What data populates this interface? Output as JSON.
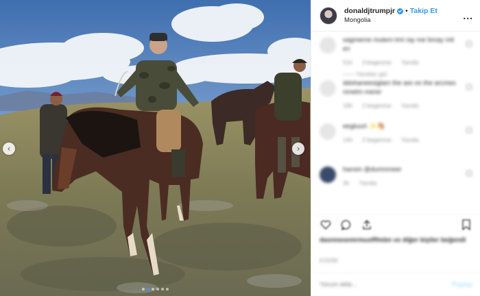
{
  "photo": {
    "description_icon": "photo-horses-mongolia",
    "prev_icon": "chevron-left-icon",
    "next_icon": "chevron-right-icon",
    "dots_total": 6,
    "dots_active": 2
  },
  "header": {
    "username": "donaldjtrumpjr",
    "separator": "•",
    "follow_label": "Takip Et",
    "location": "Mongolia",
    "more_label": "...",
    "verified_icon": "verified-badge-icon"
  },
  "comments": [
    {
      "text": "sagmeme mutem tmt ray me bmay mit en",
      "meta": [
        "51h",
        "3 begenme",
        "Yanıtla"
      ],
      "meta2": "—— Yanıtları gör",
      "avatar": "light"
    },
    {
      "text": "ddohaneesiglam the are on the arcmes nmetm merer",
      "meta": [
        "19h",
        "2 begenme",
        "Yanıtla"
      ],
      "meta2": "",
      "avatar": "light"
    },
    {
      "text": "eegtuurt ✨🐴",
      "meta": [
        "14h",
        "2 begenme",
        "Yanıtla"
      ],
      "meta2": "",
      "avatar": "light"
    },
    {
      "text": "hansin @dumnmeer",
      "meta": [
        "3h",
        "Yanıtla"
      ],
      "meta2": "",
      "avatar": "dark"
    }
  ],
  "actions": {
    "like_icon": "heart-icon",
    "comment_icon": "comment-icon",
    "share_icon": "share-icon",
    "save_icon": "bookmark-icon"
  },
  "likes_text": "dasnnesemrmusfffmbn ve diğer kişiler beğendi",
  "date_text": "8 EKİM",
  "add_comment": {
    "placeholder": "Yorum ekle...",
    "post_label": "Paylaş"
  },
  "colors": {
    "accent": "#3897f0",
    "muted": "#8e8e8e",
    "border": "#efefef"
  }
}
